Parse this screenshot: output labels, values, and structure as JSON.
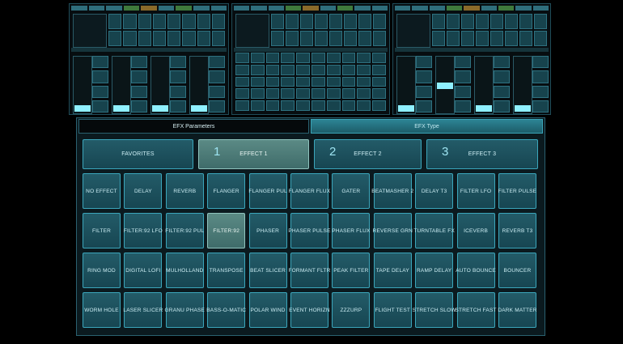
{
  "app": {
    "efx_tabs": [
      {
        "label": "EFX Parameters"
      },
      {
        "label": "EFX Type"
      }
    ],
    "categories": [
      {
        "label": "FAVORITES",
        "number": ""
      },
      {
        "label": "EFFECT 1",
        "number": "1"
      },
      {
        "label": "EFFECT 2",
        "number": "2"
      },
      {
        "label": "EFFECT 3",
        "number": "3"
      }
    ],
    "effects": [
      [
        "NO EFFECT",
        "DELAY",
        "REVERB",
        "FLANGER",
        "FLANGER PUL",
        "FLANGER FLUX",
        "GATER",
        "BEATMASHER 2",
        "DELAY T3",
        "FILTER LFO",
        "FILTER PULSE"
      ],
      [
        "FILTER",
        "FILTER:92 LFO",
        "FILTER:92 PUL",
        "FILTER:92",
        "PHASER",
        "PHASER PULSE",
        "PHASER FLUX",
        "REVERSE GRN",
        "TURNTABLE FX",
        "ICEVERB",
        "REVERB T3"
      ],
      [
        "RING MOD",
        "DIGITAL LOFI",
        "MULHOLLAND",
        "TRANSPOSE",
        "BEAT SLICER",
        "FORMANT FLTR",
        "PEAK FILTER",
        "TAPE DELAY",
        "RAMP DELAY",
        "AUTO BOUNCE",
        "BOUNCER"
      ],
      [
        "WORM HOLE",
        "LASER SLICER",
        "GRANU PHASE",
        "BASS-O-MATIC",
        "POLAR WIND",
        "EVENT HORIZN",
        "ZZZURP",
        "FLIGHT TEST",
        "STRETCH SLOW",
        "STRETCH FAST",
        "DARK MATTER"
      ]
    ],
    "selected_category": "EFFECT 1",
    "selected_effect": "FILTER:92",
    "colors": {
      "accent": "#3ba6bb",
      "panel": "#0b1a1f",
      "selected": "#5b8a85"
    }
  }
}
